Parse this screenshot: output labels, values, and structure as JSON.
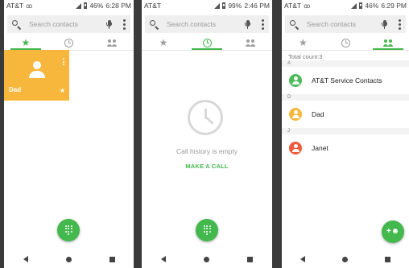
{
  "status_bars": [
    {
      "carrier": "AT&T",
      "battery": "46%",
      "time": "6:28 PM"
    },
    {
      "carrier": "AT&T",
      "battery": "99%",
      "time": "2:46 PM"
    },
    {
      "carrier": "AT&T",
      "battery": "46%",
      "time": "6:29 PM"
    }
  ],
  "search": {
    "placeholder": "Search contacts"
  },
  "favorites": {
    "contact_name": "Dad",
    "star": "★"
  },
  "call_history": {
    "empty_text": "Call history is empty",
    "make_call_label": "MAKE A CALL"
  },
  "contacts": {
    "total": "Total count:3",
    "sections": [
      {
        "letter": "A",
        "name": "AT&T Service Contacts",
        "color": "#4cbb5a"
      },
      {
        "letter": "D",
        "name": "Dad",
        "color": "#f6b73c"
      },
      {
        "letter": "J",
        "name": "Janet",
        "color": "#ef5b3b"
      }
    ]
  },
  "colors": {
    "accent": "#43b84d",
    "favorite_card": "#f6b73c"
  },
  "icons": [
    "search-icon",
    "mic-icon",
    "more-icon",
    "star-icon",
    "clock-icon",
    "people-icon",
    "dialpad-icon",
    "add-contact-icon"
  ]
}
